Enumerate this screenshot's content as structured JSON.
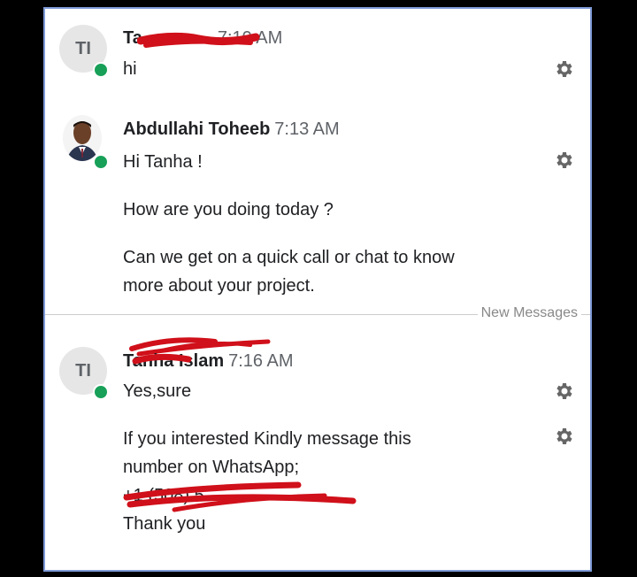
{
  "messages": [
    {
      "initials": "TI",
      "name": "Ta",
      "time": "7:10 AM",
      "texts": [
        "hi"
      ]
    },
    {
      "name": "Abdullahi Toheeb",
      "time": "7:13 AM",
      "texts": [
        "Hi Tanha !",
        "How are you doing today ?",
        "Can we get on a quick call or chat to know",
        "more about your project."
      ]
    },
    {
      "initials": "TI",
      "name": "Tanha Islam",
      "time": "7:16 AM",
      "texts": [
        "Yes,sure",
        "If you interested Kindly message this",
        "number on WhatsApp;",
        "+1 (508) 5",
        "Thank you"
      ]
    }
  ],
  "divider": {
    "label": "New Messages"
  },
  "colors": {
    "presence": "#18a058",
    "redaction": "#d0101a",
    "frame": "#7f9bd7"
  },
  "icons": {
    "settings": "gear-icon"
  }
}
